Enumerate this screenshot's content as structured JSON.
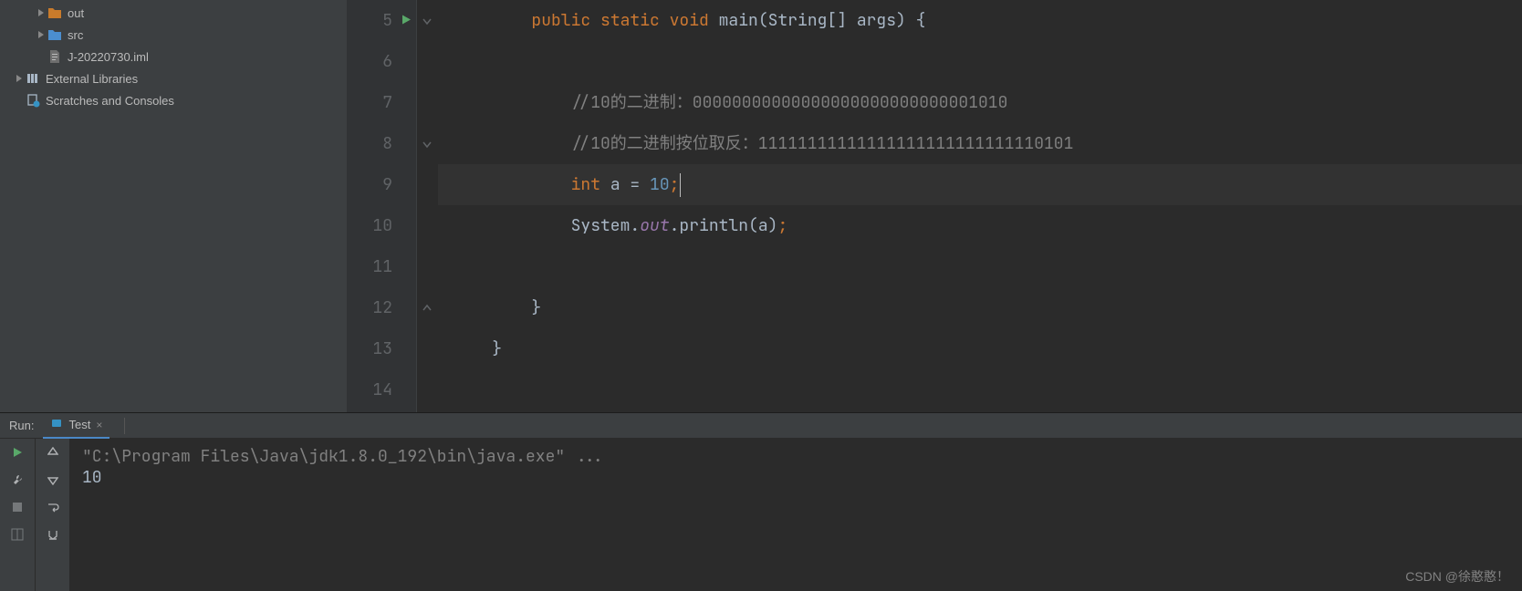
{
  "tree": {
    "out": "out",
    "src": "src",
    "iml": "J-20220730.iml",
    "external": "External Libraries",
    "scratches": "Scratches and Consoles"
  },
  "editor": {
    "lineStart": 5,
    "lines": {
      "5": {
        "indent": "        ",
        "tokens": [
          {
            "t": "public ",
            "c": "kw"
          },
          {
            "t": "static ",
            "c": "kw"
          },
          {
            "t": "void ",
            "c": "kw"
          },
          {
            "t": "main(String[] args) {",
            "c": "ident"
          }
        ]
      },
      "6": {
        "indent": "",
        "tokens": []
      },
      "7": {
        "indent": "            ",
        "tokens": [
          {
            "t": "//10的二进制：00000000000000000000000000001010",
            "c": "comment"
          }
        ]
      },
      "8": {
        "indent": "            ",
        "tokens": [
          {
            "t": "//10的二进制按位取反：11111111111111111111111111110101",
            "c": "comment"
          }
        ]
      },
      "9": {
        "indent": "            ",
        "tokens": [
          {
            "t": "int ",
            "c": "kw"
          },
          {
            "t": "a = ",
            "c": "ident"
          },
          {
            "t": "10",
            "c": "num"
          },
          {
            "t": ";",
            "c": "semi"
          }
        ],
        "active": true,
        "caret": true
      },
      "10": {
        "indent": "            ",
        "tokens": [
          {
            "t": "System.",
            "c": "ident"
          },
          {
            "t": "out",
            "c": "str-out"
          },
          {
            "t": ".println(a)",
            "c": "ident"
          },
          {
            "t": ";",
            "c": "semi"
          }
        ]
      },
      "11": {
        "indent": "",
        "tokens": []
      },
      "12": {
        "indent": "        ",
        "tokens": [
          {
            "t": "}",
            "c": "ident"
          }
        ]
      },
      "13": {
        "indent": "    ",
        "tokens": [
          {
            "t": "}",
            "c": "ident"
          }
        ]
      },
      "14": {
        "indent": "",
        "tokens": []
      }
    }
  },
  "run": {
    "label": "Run:",
    "tabName": "Test",
    "cmd": "\"C:\\Program Files\\Java\\jdk1.8.0_192\\bin\\java.exe\" ...",
    "output": "10"
  },
  "watermark": "CSDN @徐憨憨！"
}
